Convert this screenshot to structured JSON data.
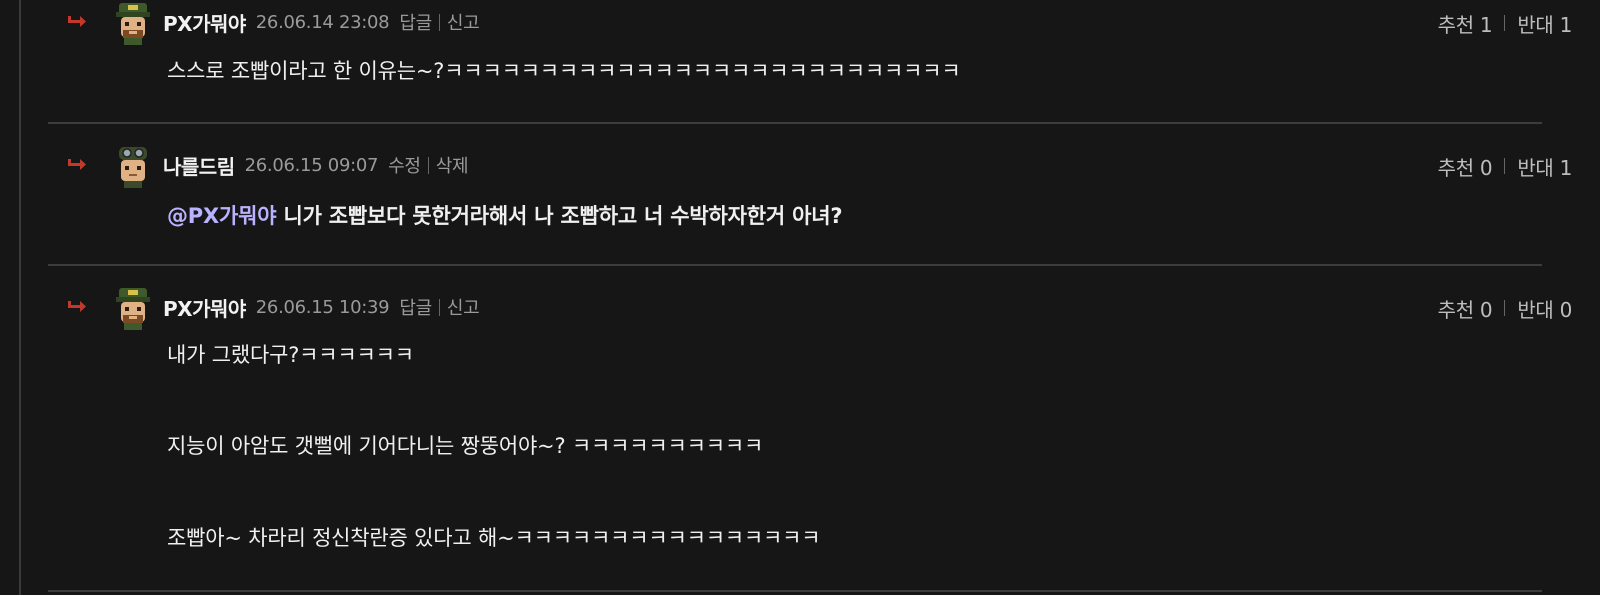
{
  "comments": [
    {
      "author": "PX가뭐야",
      "date": "26.06.14 23:08",
      "actions": [
        "답글",
        "신고"
      ],
      "votes": {
        "up_label": "추천 1",
        "down_label": "반대 1"
      },
      "lines": [
        "스스로 조빱이라고 한 이유는~?ㅋㅋㅋㅋㅋㅋㅋㅋㅋㅋㅋㅋㅋㅋㅋㅋㅋㅋㅋㅋㅋㅋㅋㅋㅋㅋㅋ"
      ]
    },
    {
      "author": "나를드림",
      "date": "26.06.15 09:07",
      "actions": [
        "수정",
        "삭제"
      ],
      "votes": {
        "up_label": "추천 0",
        "down_label": "반대 1"
      },
      "mention": "@PX가뭐야",
      "lines": [
        " 니가 조빱보다 못한거라해서 나 조빱하고 너 수박하자한거 아녀?"
      ]
    },
    {
      "author": "PX가뭐야",
      "date": "26.06.15 10:39",
      "actions": [
        "답글",
        "신고"
      ],
      "votes": {
        "up_label": "추천 0",
        "down_label": "반대 0"
      },
      "lines": [
        "내가 그랬다구?ㅋㅋㅋㅋㅋㅋ",
        "지능이 아암도 갯뻘에 기어다니는 짱뚱어야~? ㅋㅋㅋㅋㅋㅋㅋㅋㅋㅋ",
        "조빱아~ 차라리 정신착란증 있다고 해~ㅋㅋㅋㅋㅋㅋㅋㅋㅋㅋㅋㅋㅋㅋㅋㅋ"
      ]
    }
  ],
  "colors": {
    "background": "#161616",
    "mention": "#b9b2ff",
    "reply_arrow": "#c0392b"
  },
  "icons": {
    "reply": "reply-arrow-icon",
    "avatar_a": "soldier-avatar-icon",
    "avatar_b": "goggles-soldier-avatar-icon"
  }
}
